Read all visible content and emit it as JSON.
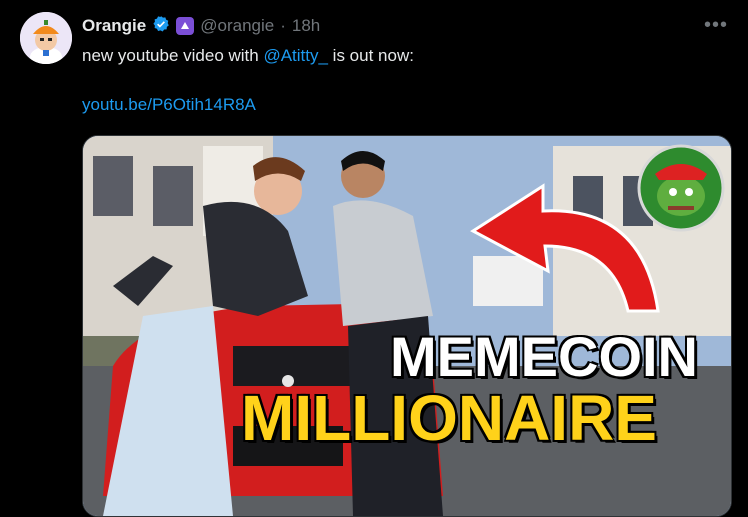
{
  "post": {
    "display_name": "Orangie",
    "handle": "@orangie",
    "separator": "·",
    "time": "18h",
    "more_label": "•••",
    "text_before": "new youtube video with ",
    "mention": "@Atitty_",
    "text_after": " is out now:",
    "link": "youtu.be/P6Otih14R8A"
  },
  "thumbnail": {
    "line1": "MEMECOIN",
    "line2": "MILLIONAIRE"
  },
  "icons": {
    "verified": "verified-badge-icon",
    "affiliate": "affiliate-badge-icon",
    "more": "more-options-icon",
    "pepe": "pepe-logo-icon"
  },
  "colors": {
    "background": "#000000",
    "link": "#1d9bf0",
    "muted": "#71767b",
    "title_yellow": "#ffd21a"
  }
}
